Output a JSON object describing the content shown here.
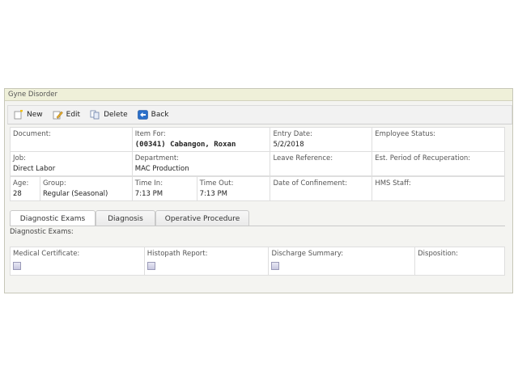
{
  "panel": {
    "title": "Gyne Disorder"
  },
  "toolbar": {
    "new_label": "New",
    "edit_label": "Edit",
    "delete_label": "Delete",
    "back_label": "Back"
  },
  "fields": {
    "document_label": "Document:",
    "item_for_label": "Item For:",
    "item_for_value": "(00341) Cabangon, Roxan",
    "entry_date_label": "Entry Date:",
    "entry_date_value": "5/2/2018",
    "employee_status_label": "Employee Status:",
    "job_label": "Job:",
    "job_value": "Direct Labor",
    "department_label": "Department:",
    "department_value": "MAC Production",
    "leave_reference_label": "Leave Reference:",
    "est_period_label": "Est. Period of Recuperation:",
    "age_label": "Age:",
    "age_value": "28",
    "group_label": "Group:",
    "group_value": "Regular (Seasonal)",
    "time_in_label": "Time In:",
    "time_in_value": "7:13 PM",
    "time_out_label": "Time Out:",
    "time_out_value": "7:13 PM",
    "date_confinement_label": "Date of Confinement:",
    "hms_staff_label": "HMS Staff:"
  },
  "tabs": [
    {
      "label": "Diagnostic Exams"
    },
    {
      "label": "Diagnosis"
    },
    {
      "label": "Operative Procedure"
    }
  ],
  "diagnostic": {
    "section_label": "Diagnostic Exams:",
    "medical_certificate_label": "Medical Certificate:",
    "histopath_label": "Histopath Report:",
    "discharge_label": "Discharge Summary:",
    "disposition_label": "Disposition:"
  },
  "icons": {
    "new": "new-document-icon",
    "edit": "edit-pencil-icon",
    "delete": "delete-copy-icon",
    "back": "back-arrow-icon"
  }
}
